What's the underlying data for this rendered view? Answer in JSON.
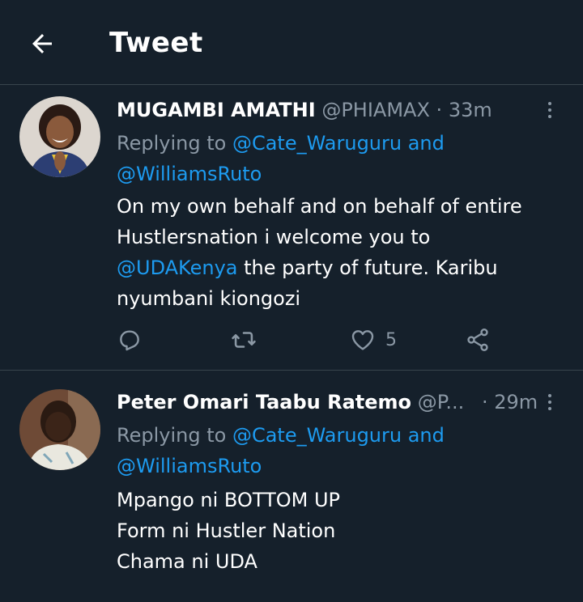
{
  "header": {
    "title": "Tweet"
  },
  "tweets": [
    {
      "display_name": "MUGAMBI AMATHI",
      "handle": "@PHIAMAX",
      "separator": "·",
      "time": "33m",
      "replying_prefix": "Replying to",
      "reply_mentions": [
        "@Cate_Waruguru and",
        "@WilliamsRuto"
      ],
      "body": {
        "line1": "On my own behalf and on behalf of entire",
        "line2": "Hustlersnation i welcome you to",
        "mention": "@UDAKenya",
        "line3_rest": " the party of future. Karibu",
        "line4": "nyumbani kiongozi"
      },
      "like_count": "5"
    },
    {
      "display_name": "Peter Omari Taabu Ratemo",
      "handle": "@P...",
      "separator": "·",
      "time": "29m",
      "replying_prefix": "Replying to",
      "reply_mentions": [
        "@Cate_Waruguru and",
        "@WilliamsRuto"
      ],
      "body_lines": [
        "Mpango ni BOTTOM UP",
        "Form ni Hustler Nation",
        "Chama ni UDA"
      ]
    }
  ],
  "colors": {
    "background": "#15202b",
    "divider": "#38444d",
    "secondary_text": "#8b98a5",
    "link": "#1d9bf0"
  },
  "icons": {
    "back": "arrow-left-icon",
    "more": "more-vertical-icon",
    "reply": "reply-icon",
    "retweet": "retweet-icon",
    "like": "heart-icon",
    "share": "share-icon"
  }
}
